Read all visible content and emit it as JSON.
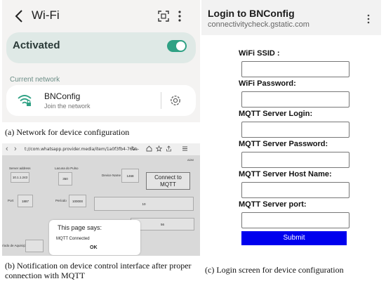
{
  "panel_a": {
    "title": "Wi-Fi",
    "activated_label": "Activated",
    "wifi_enabled": true,
    "section_label": "Current network",
    "network": {
      "name": "BNConfig",
      "status": "Join the network"
    },
    "accent_color": "#2fa184"
  },
  "caption_a": "(a) Network for device configuration",
  "panel_b": {
    "url": "t://com.whatsapp.provider.media/item/1a0f3fb4-76aa-",
    "adm": "ADM",
    "labels": {
      "server_address": "Server address",
      "lacuna": "Lacuna do Pulso",
      "device_name": "Device Name",
      "port": "Port",
      "periodo": "Período",
      "periodo_aquisicao": "ríodo de Aquisição"
    },
    "values": {
      "server_address": "10.1.1.243",
      "lacuna": "350",
      "device_name": "1468",
      "port": "1887",
      "periodo": "100000",
      "wide_field": "10",
      "field_56": "56"
    },
    "connect_button": "Connect to MQTT",
    "dialog": {
      "title": "This page says:",
      "message": "MQTT Connected",
      "ok": "OK"
    }
  },
  "caption_b": "(b) Notification on device control interface after proper connection with MQTT",
  "panel_c": {
    "title": "Login to BNConfig",
    "url": "connectivitycheck.gstatic.com",
    "fields": [
      {
        "label": "WiFi SSID :"
      },
      {
        "label": "WiFi Password:"
      },
      {
        "label": "MQTT Server Login:"
      },
      {
        "label": "MQTT Server Password:"
      },
      {
        "label": "MQTT Server Host Name:"
      },
      {
        "label": "MQTT Server port:"
      }
    ],
    "submit": "Submit",
    "submit_color": "#0000ee"
  },
  "caption_c": "(c) Login screen for device configuration"
}
